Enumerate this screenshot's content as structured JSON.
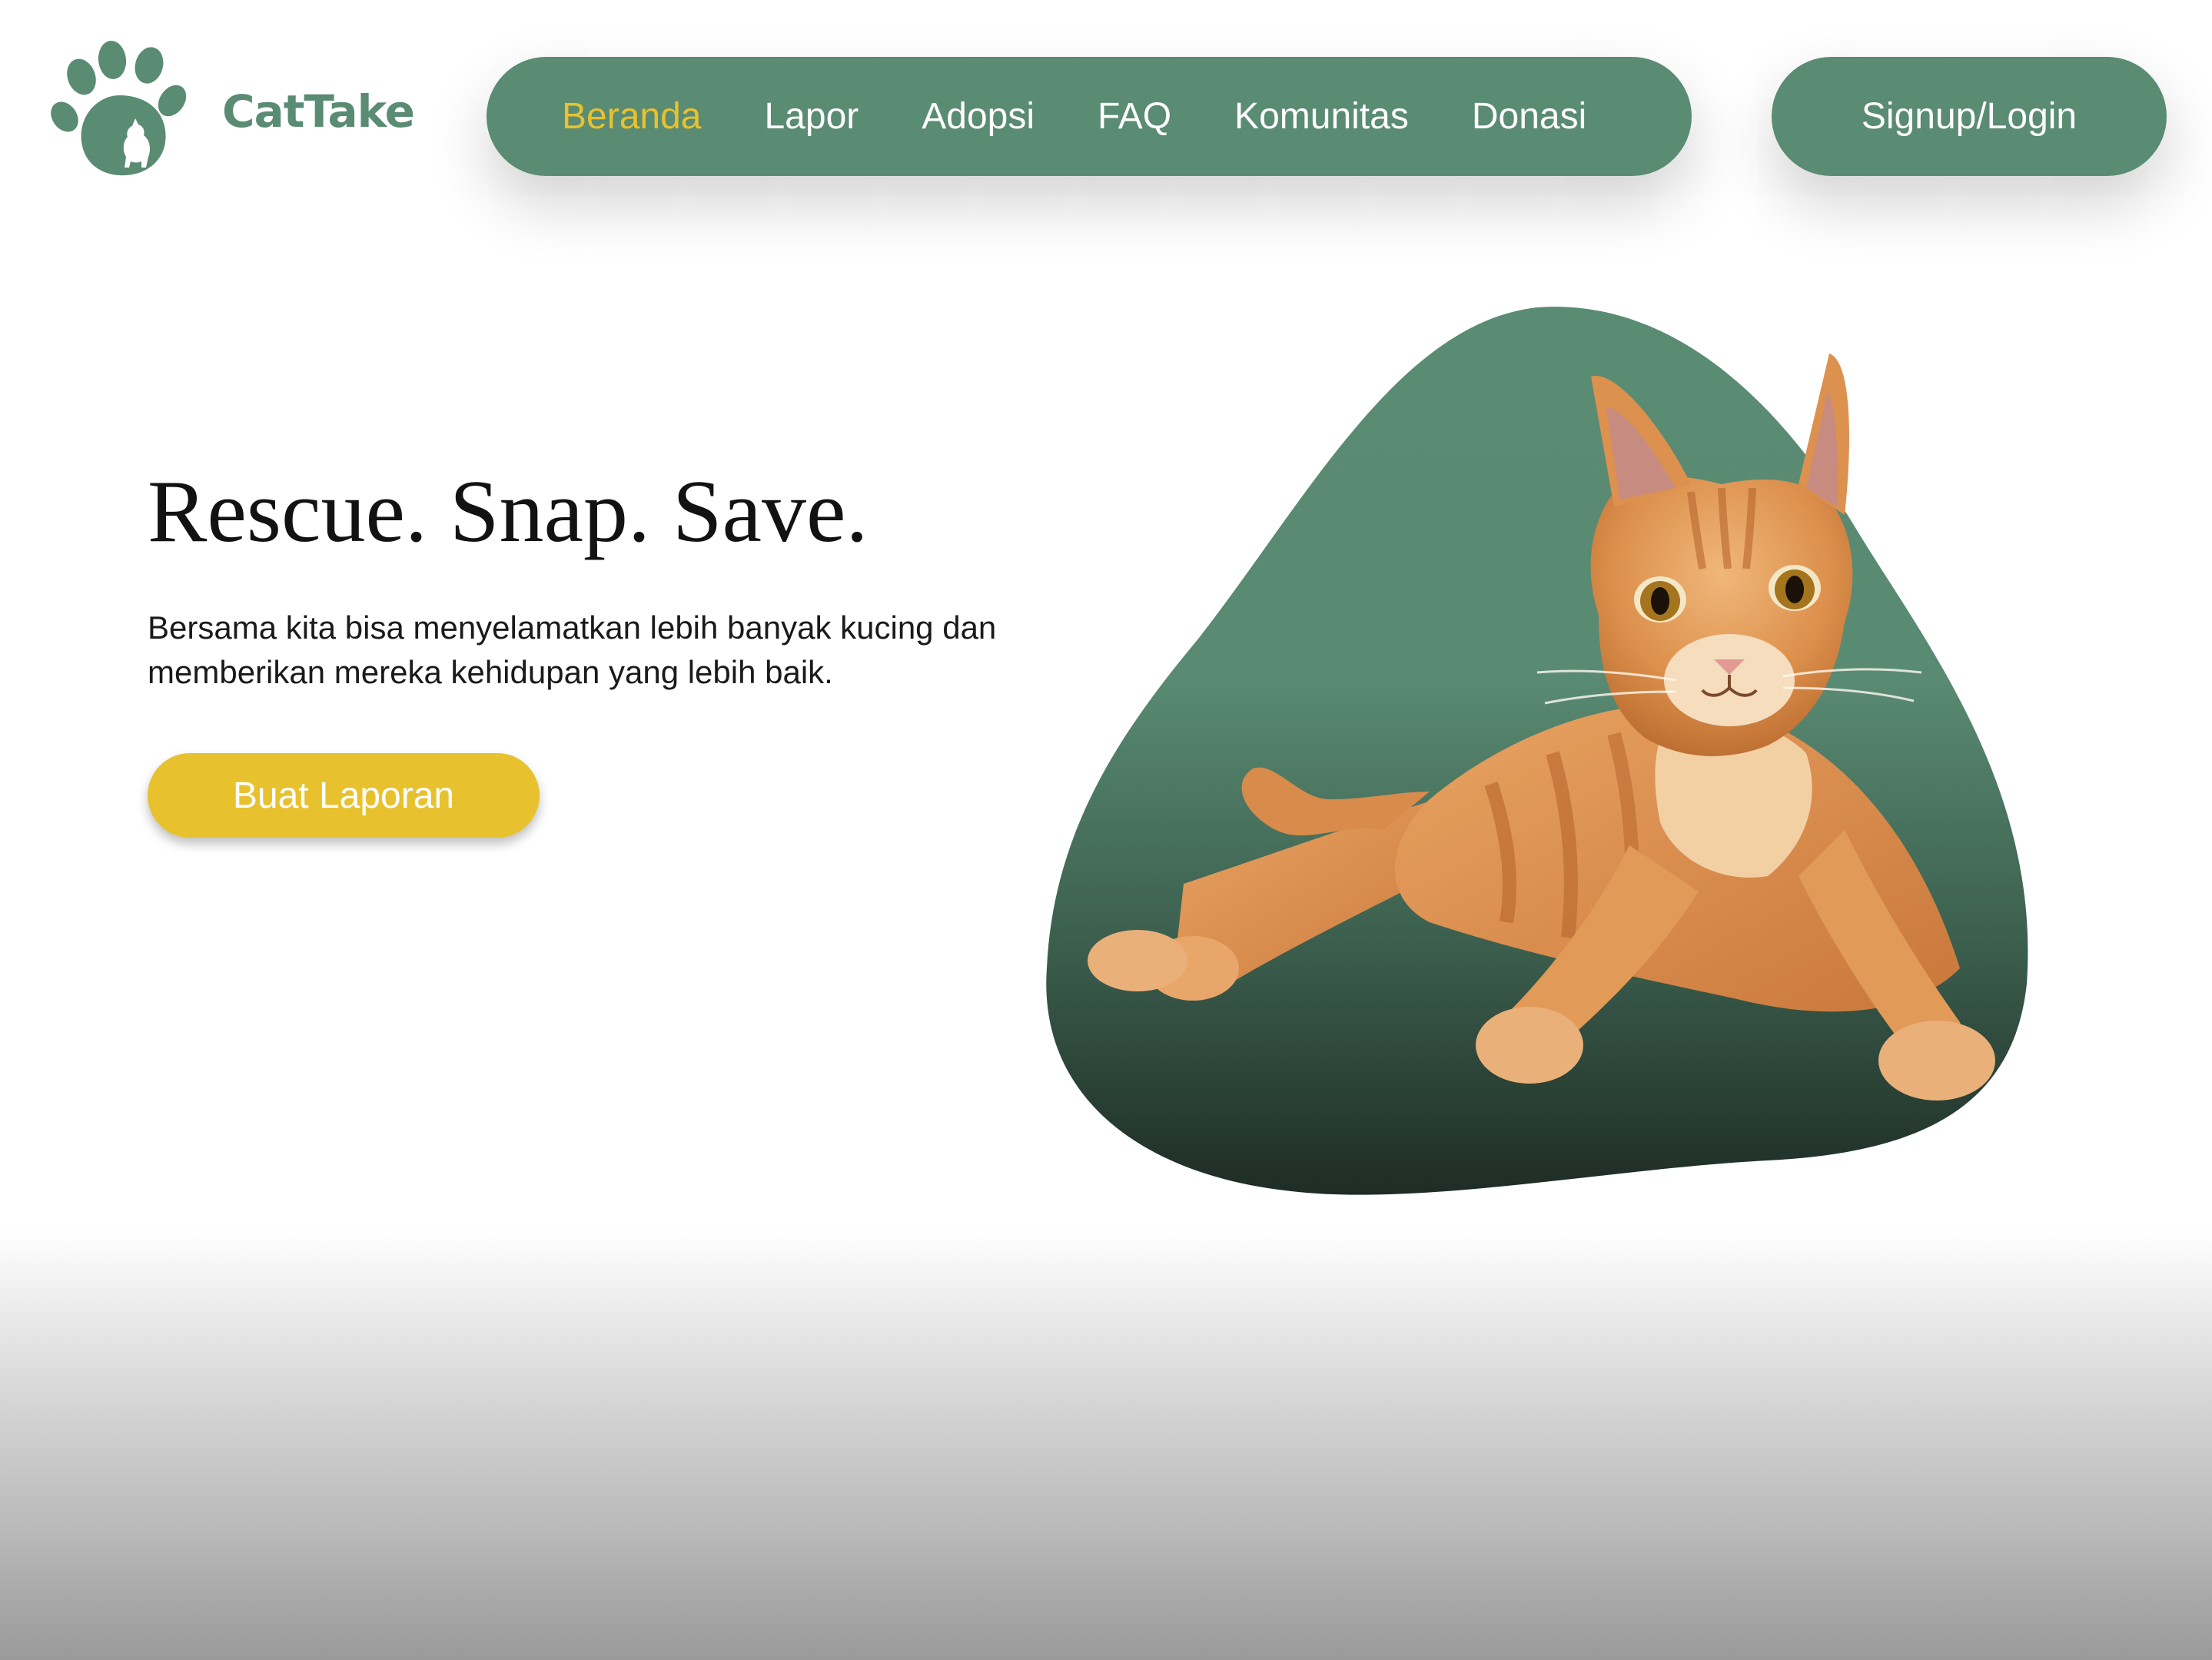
{
  "brand": {
    "name": "CatTake",
    "logo_icon": "paw-cat-icon"
  },
  "nav": {
    "items": [
      {
        "label": "Beranda",
        "active": true
      },
      {
        "label": "Lapor",
        "active": false
      },
      {
        "label": "Adopsi",
        "active": false
      },
      {
        "label": "FAQ",
        "active": false
      },
      {
        "label": "Komunitas",
        "active": false
      },
      {
        "label": "Donasi",
        "active": false
      }
    ]
  },
  "auth": {
    "signup_label": "Signup/Login"
  },
  "hero": {
    "title": "Rescue. Snap. Save.",
    "description": "Bersama kita bisa menyelamatkan lebih banyak kucing dan memberikan mereka kehidupan yang lebih baik.",
    "cta_label": "Buat Laporan",
    "image": "orange-tabby-cat-illustration"
  },
  "colors": {
    "primary": "#5a8b73",
    "accent": "#e8c22e",
    "text": "#121212",
    "background": "#ffffff"
  }
}
